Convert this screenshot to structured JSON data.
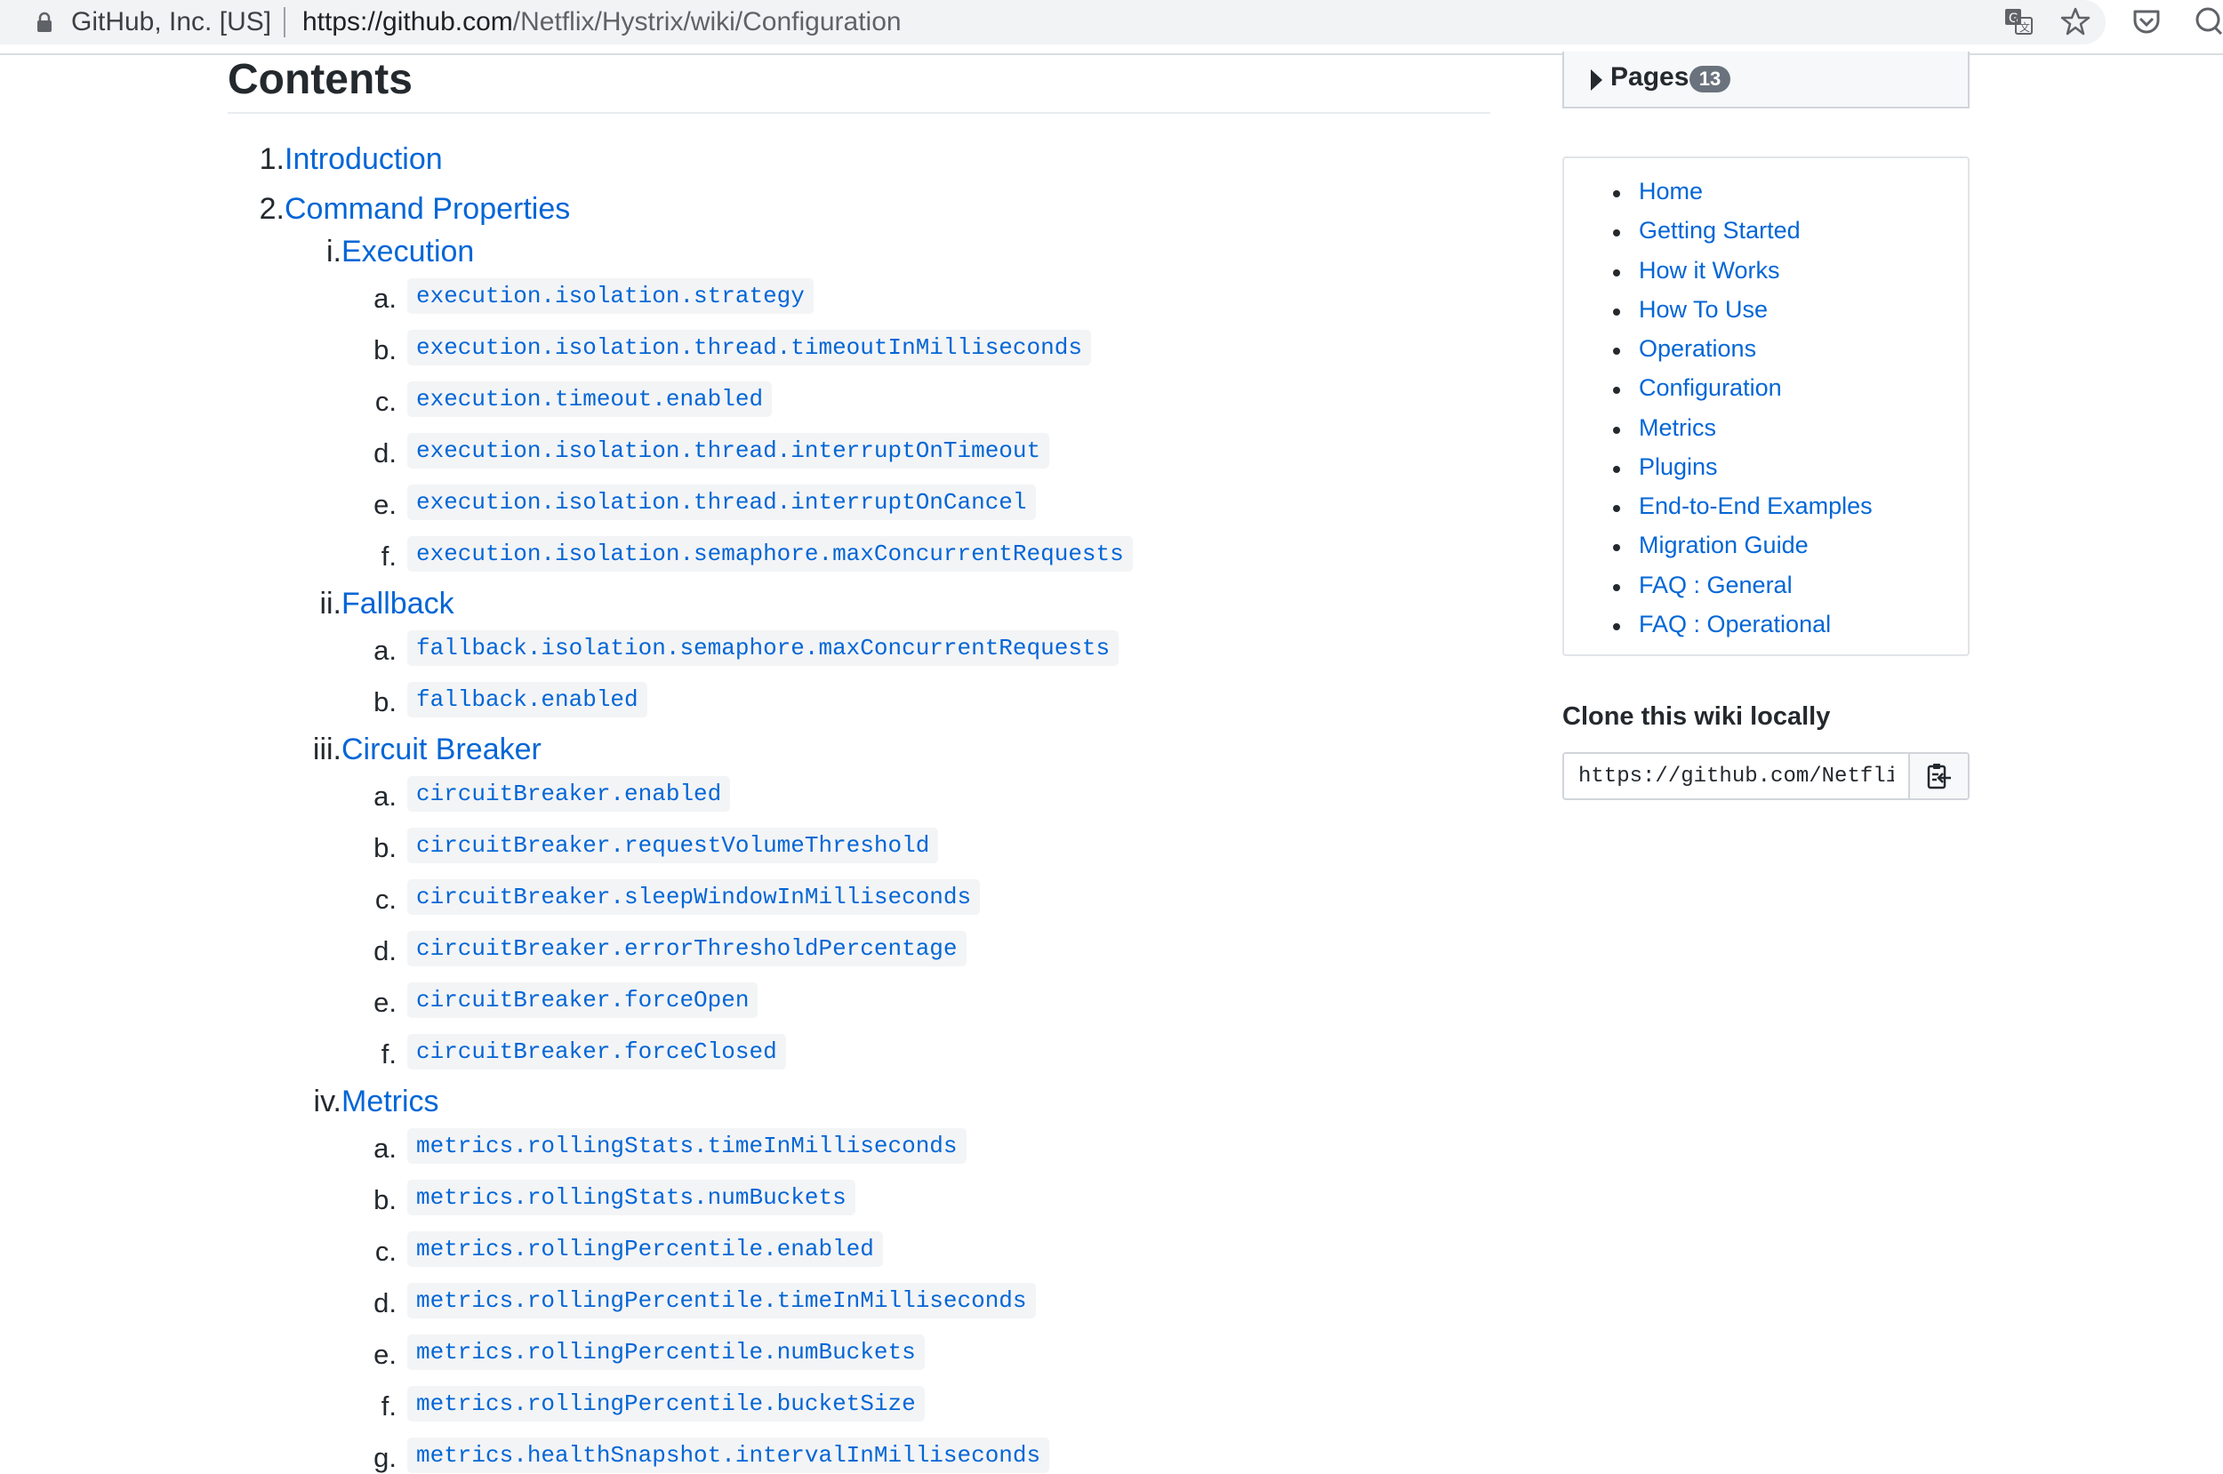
{
  "browser": {
    "site_name": "GitHub, Inc. [US]",
    "url_host": "https://github.com",
    "url_path": "/Netflix/Hystrix/wiki/Configuration"
  },
  "contents": {
    "title": "Contents",
    "items": [
      {
        "marker": "1.",
        "label": "Introduction"
      },
      {
        "marker": "2.",
        "label": "Command Properties"
      }
    ],
    "sections": [
      {
        "marker": "i.",
        "label": "Execution",
        "props": [
          {
            "marker": "a.",
            "code": "execution.isolation.strategy"
          },
          {
            "marker": "b.",
            "code": "execution.isolation.thread.timeoutInMilliseconds"
          },
          {
            "marker": "c.",
            "code": "execution.timeout.enabled"
          },
          {
            "marker": "d.",
            "code": "execution.isolation.thread.interruptOnTimeout"
          },
          {
            "marker": "e.",
            "code": "execution.isolation.thread.interruptOnCancel"
          },
          {
            "marker": "f.",
            "code": "execution.isolation.semaphore.maxConcurrentRequests"
          }
        ]
      },
      {
        "marker": "ii.",
        "label": "Fallback",
        "props": [
          {
            "marker": "a.",
            "code": "fallback.isolation.semaphore.maxConcurrentRequests"
          },
          {
            "marker": "b.",
            "code": "fallback.enabled"
          }
        ]
      },
      {
        "marker": "iii.",
        "label": "Circuit Breaker",
        "props": [
          {
            "marker": "a.",
            "code": "circuitBreaker.enabled"
          },
          {
            "marker": "b.",
            "code": "circuitBreaker.requestVolumeThreshold"
          },
          {
            "marker": "c.",
            "code": "circuitBreaker.sleepWindowInMilliseconds"
          },
          {
            "marker": "d.",
            "code": "circuitBreaker.errorThresholdPercentage"
          },
          {
            "marker": "e.",
            "code": "circuitBreaker.forceOpen"
          },
          {
            "marker": "f.",
            "code": "circuitBreaker.forceClosed"
          }
        ]
      },
      {
        "marker": "iv.",
        "label": "Metrics",
        "props": [
          {
            "marker": "a.",
            "code": "metrics.rollingStats.timeInMilliseconds"
          },
          {
            "marker": "b.",
            "code": "metrics.rollingStats.numBuckets"
          },
          {
            "marker": "c.",
            "code": "metrics.rollingPercentile.enabled"
          },
          {
            "marker": "d.",
            "code": "metrics.rollingPercentile.timeInMilliseconds"
          },
          {
            "marker": "e.",
            "code": "metrics.rollingPercentile.numBuckets"
          },
          {
            "marker": "f.",
            "code": "metrics.rollingPercentile.bucketSize"
          },
          {
            "marker": "g.",
            "code": "metrics.healthSnapshot.intervalInMilliseconds"
          }
        ]
      }
    ]
  },
  "sidebar": {
    "pages_label": "Pages",
    "pages_count": "13",
    "nav": [
      "Home",
      "Getting Started",
      "How it Works",
      "How To Use",
      "Operations",
      "Configuration",
      "Metrics",
      "Plugins",
      "End-to-End Examples",
      "Migration Guide",
      "FAQ : General",
      "FAQ : Operational"
    ],
    "clone_title": "Clone this wiki locally",
    "clone_url": "https://github.com/Netflix/Hystrix.wiki.git"
  },
  "colors": {
    "link": "#0366d6",
    "text": "#24292e",
    "code_bg": "#f3f4f6"
  },
  "icons": [
    "lock-icon",
    "translate-icon",
    "star-icon",
    "pocket-icon",
    "profile-icon",
    "clippy-icon"
  ]
}
